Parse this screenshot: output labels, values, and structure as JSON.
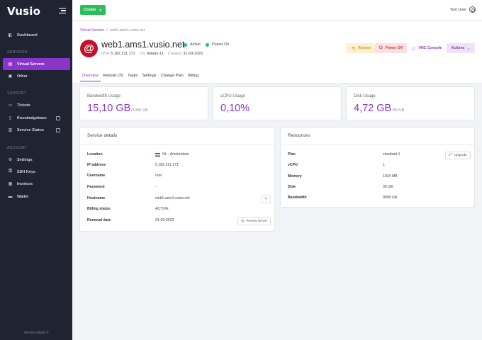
{
  "app": {
    "logo": "Vusio",
    "version": "Version Alpha 0"
  },
  "sidebar": {
    "top": [
      {
        "label": "Dashboard",
        "icon": "dashboard-icon",
        "glyph": "◧"
      }
    ],
    "sections": [
      {
        "title": "SERVICES",
        "items": [
          {
            "label": "Virtual Servers",
            "icon": "server-icon",
            "glyph": "▤",
            "active": true
          },
          {
            "label": "Other",
            "icon": "box-icon",
            "glyph": "▣"
          }
        ]
      },
      {
        "title": "SUPPORT",
        "items": [
          {
            "label": "Tickets",
            "icon": "ticket-icon",
            "glyph": "▭"
          },
          {
            "label": "Knowledgebase",
            "icon": "book-icon",
            "glyph": "▯"
          },
          {
            "label": "Service Status",
            "icon": "status-icon",
            "glyph": "▥"
          }
        ]
      },
      {
        "title": "ACCOUNT",
        "items": [
          {
            "label": "Settings",
            "icon": "gear-icon",
            "glyph": "⚙"
          },
          {
            "label": "SSH Keys",
            "icon": "key-icon",
            "glyph": "⚿"
          },
          {
            "label": "Invoices",
            "icon": "invoice-icon",
            "glyph": "▦"
          },
          {
            "label": "Wallet",
            "icon": "wallet-icon",
            "glyph": "▬"
          }
        ]
      }
    ]
  },
  "topbar": {
    "create_label": "Create",
    "user_name": "Test User"
  },
  "breadcrumb": {
    "parent": "Virtual Servers",
    "sep": "/",
    "current": "web1.ams1.vusio.net"
  },
  "server": {
    "os_logo_glyph": "@",
    "hostname": "web1.ams1.vusio.net",
    "status_active": "Active",
    "status_power": "Power On",
    "ipv4_label": "IPv4",
    "ipv4": "5.182.211.171",
    "os_label": "OS",
    "os": "debian-11",
    "created_label": "Created",
    "created": "31-03-2022"
  },
  "actions": {
    "reboot": "Reboot",
    "power_off": "Power Off",
    "vnc": "VNC Console",
    "more": "Actions"
  },
  "tabs": [
    "Overview",
    "Rebuild OS",
    "Tasks",
    "Settings",
    "Change Plan",
    "Billing"
  ],
  "usage": {
    "bandwidth": {
      "label": "Bandwidth Usage",
      "value": "15,10 GB",
      "unit": "/1000 GB"
    },
    "vcpu": {
      "label": "vCPU Usage",
      "value": "0,10%"
    },
    "disk": {
      "label": "Disk Usage",
      "value": "4,72 GB",
      "unit": "/30 GB"
    }
  },
  "service_details": {
    "title": "Service details",
    "rows": [
      {
        "k": "Location",
        "v": "NL - Amsterdam"
      },
      {
        "k": "IP address",
        "v": "5.182.211.171"
      },
      {
        "k": "Username",
        "v": "root"
      },
      {
        "k": "Password",
        "v": "-"
      },
      {
        "k": "Hostname",
        "v": "web1.ams1.vusio.net"
      },
      {
        "k": "Billing status",
        "v": "ACTIVE"
      },
      {
        "k": "Renewal date",
        "v": "31-03-2023"
      }
    ],
    "renew_label": "Renew server"
  },
  "resources": {
    "title": "Resources",
    "rows": [
      {
        "k": "Plan",
        "v": "standard.1"
      },
      {
        "k": "vCPU",
        "v": "1"
      },
      {
        "k": "Memory",
        "v": "1024 MB"
      },
      {
        "k": "Disk",
        "v": "30 GB"
      },
      {
        "k": "Bandwidth",
        "v": "9999 GB"
      }
    ],
    "upgrade_label": "Upgrade"
  },
  "colors": {
    "accent": "#8a35c9",
    "sidebar_bg": "#1f2332",
    "create": "#2dbd5c",
    "status_dot": "#2ab3a5"
  }
}
